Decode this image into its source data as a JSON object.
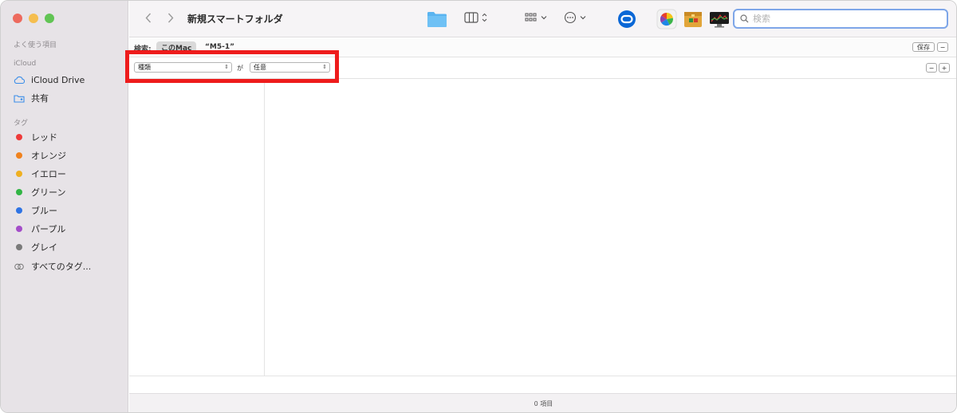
{
  "window": {
    "title": "新規スマートフォルダ"
  },
  "sidebar": {
    "favorites_header": "よく使う項目",
    "icloud_header": "iCloud",
    "icloud_items": [
      {
        "label": "iCloud Drive",
        "icon": "cloud-icon"
      },
      {
        "label": "共有",
        "icon": "shared-folder-icon"
      }
    ],
    "tags_header": "タグ",
    "tags": [
      {
        "label": "レッド",
        "color": "#ee3a3a"
      },
      {
        "label": "オレンジ",
        "color": "#f0821e"
      },
      {
        "label": "イエロー",
        "color": "#efb021"
      },
      {
        "label": "グリーン",
        "color": "#32b545"
      },
      {
        "label": "ブルー",
        "color": "#2f74e4"
      },
      {
        "label": "パープル",
        "color": "#a44dc9"
      },
      {
        "label": "グレイ",
        "color": "#7a7a7a"
      }
    ],
    "all_tags": {
      "label": "すべてのタグ...",
      "icon": "tag-all-icon"
    }
  },
  "toolbar": {
    "back_icon": "chevron-left-icon",
    "forward_icon": "chevron-right-icon",
    "icons": [
      "folder-icon",
      "column-view-icon",
      "group-grid-icon",
      "more-actions-icon",
      "app-icon-blue-ring",
      "app-icon-color-wheel",
      "app-icon-archive",
      "app-icon-monitor"
    ],
    "search_placeholder": "検索"
  },
  "scope_bar": {
    "label": "検索:",
    "scope_this_mac": "このMac",
    "scope_folder": "“M5-1”",
    "save_label": "保存",
    "remove_label": "−"
  },
  "criteria": {
    "attribute": "種類",
    "connector": "が",
    "value": "任意",
    "remove_label": "−",
    "add_label": "+"
  },
  "status": {
    "item_count": "0 項目"
  },
  "colors": {
    "highlight": "#ee1c1c",
    "search_focus": "#7ea6e8"
  }
}
